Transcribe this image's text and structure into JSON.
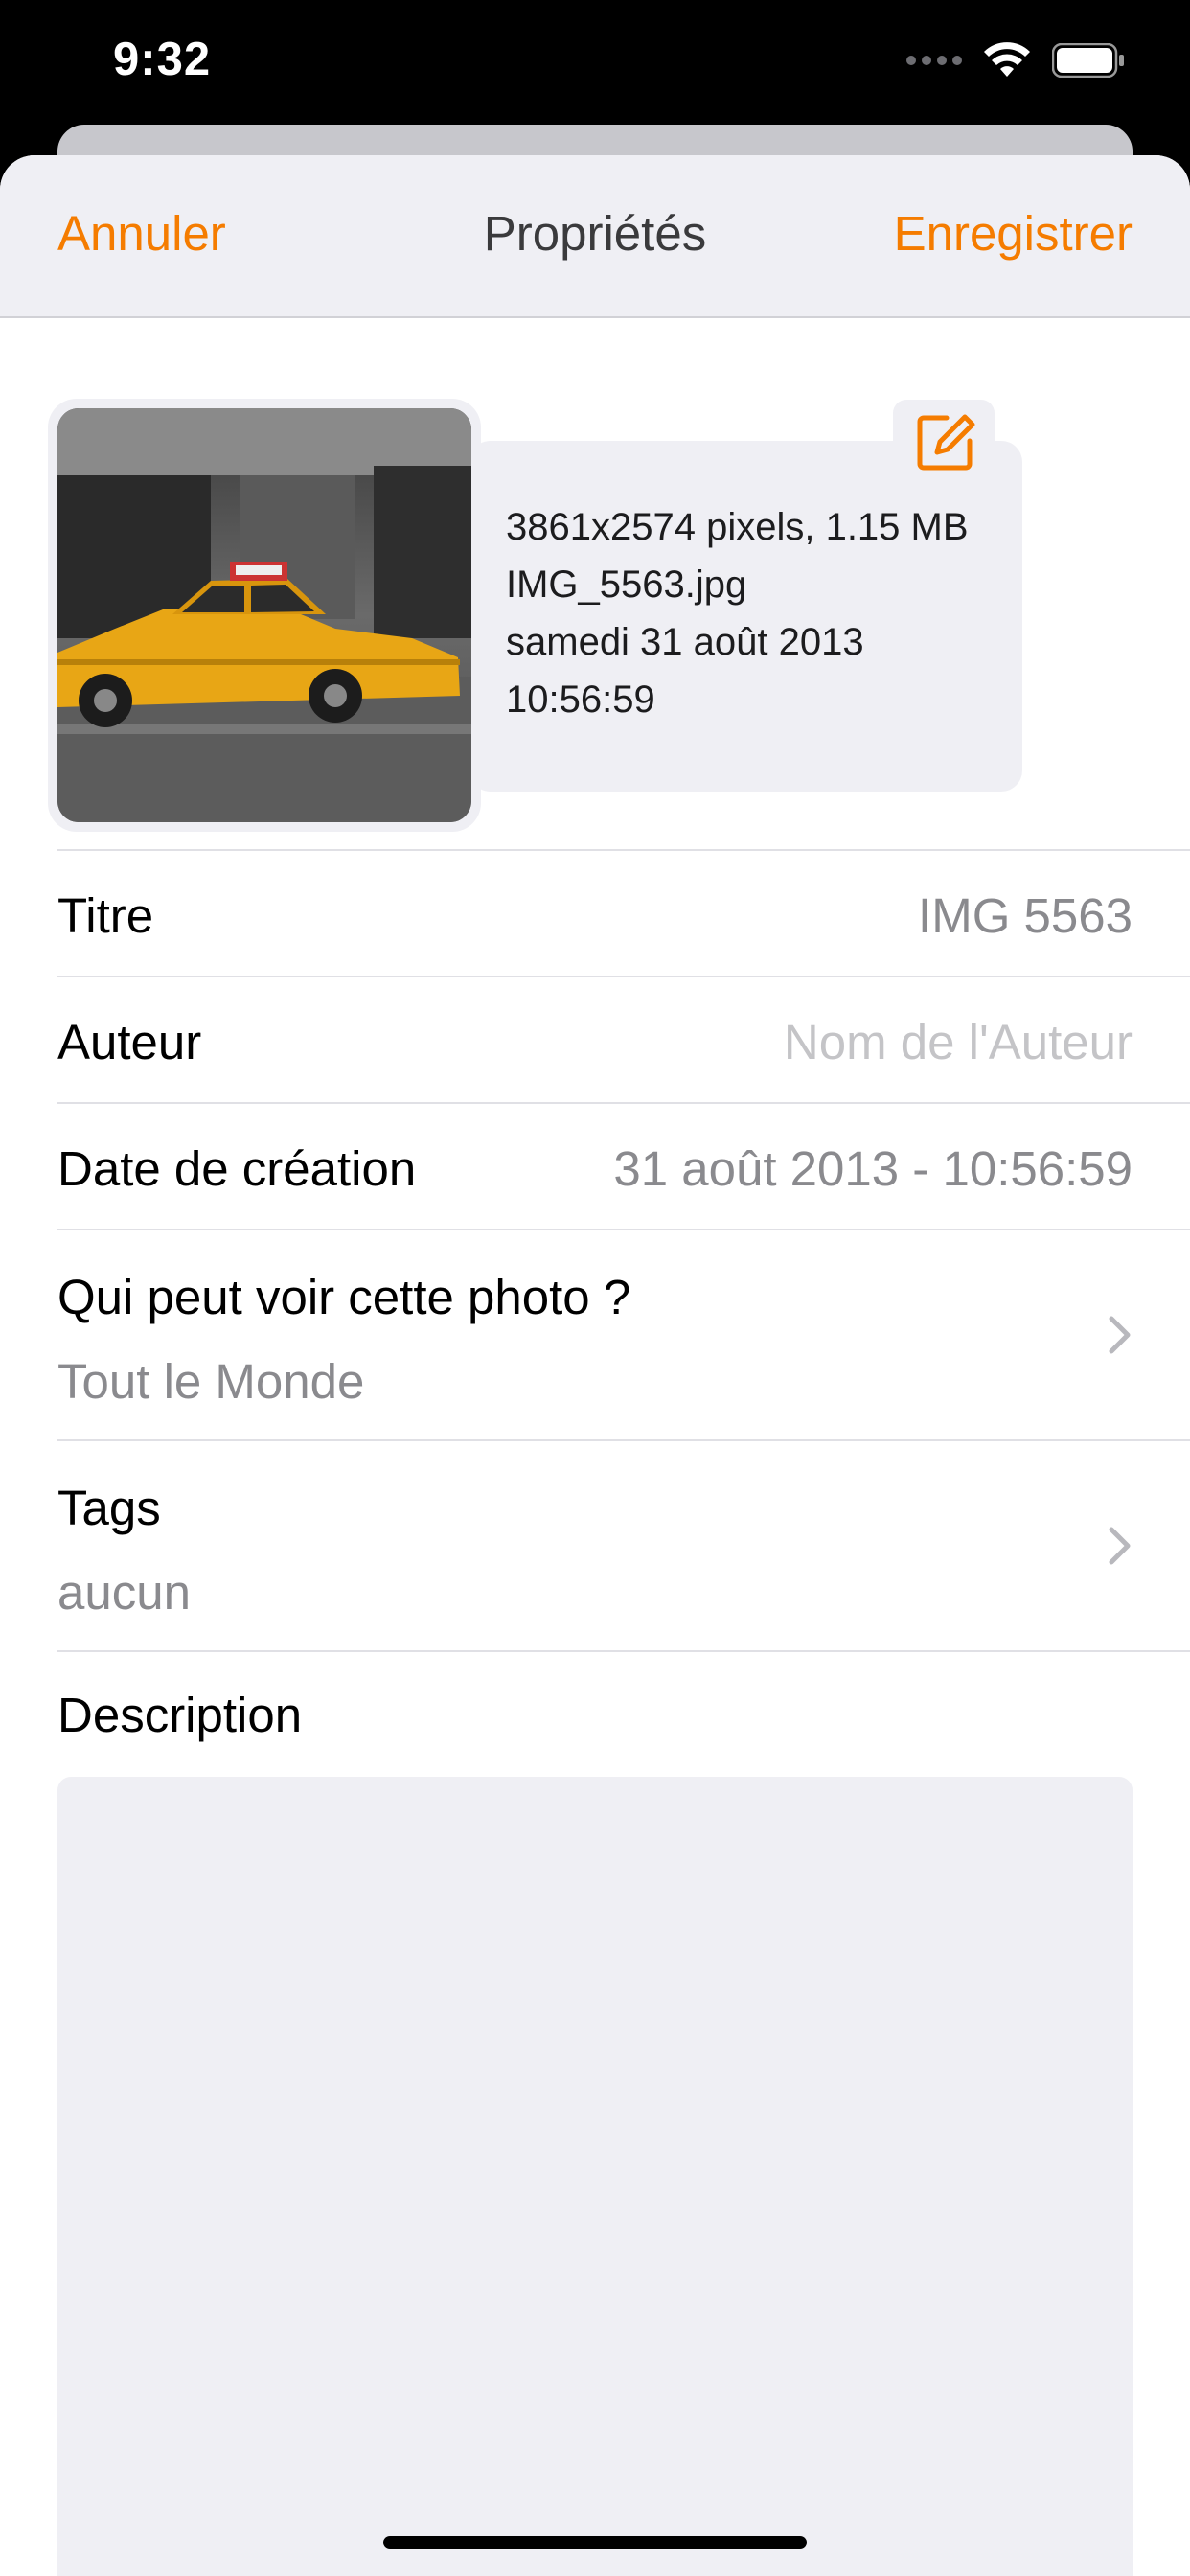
{
  "status_bar": {
    "time": "9:32"
  },
  "nav": {
    "cancel_label": "Annuler",
    "title": "Propriétés",
    "save_label": "Enregistrer"
  },
  "photo_info": {
    "dimensions_size": "3861x2574 pixels, 1.15 MB",
    "filename": "IMG_5563.jpg",
    "date": "samedi 31 août 2013",
    "time": "10:56:59"
  },
  "fields": {
    "title_label": "Titre",
    "title_value": "IMG 5563",
    "author_label": "Auteur",
    "author_placeholder": "Nom de l'Auteur",
    "creation_label": "Date de création",
    "creation_value": "31 août 2013 - 10:56:59",
    "visibility_label": "Qui peut voir cette photo ?",
    "visibility_value": "Tout le Monde",
    "tags_label": "Tags",
    "tags_value": "aucun",
    "description_label": "Description"
  },
  "colors": {
    "accent": "#f57c00",
    "background_gray": "#efeff4"
  }
}
